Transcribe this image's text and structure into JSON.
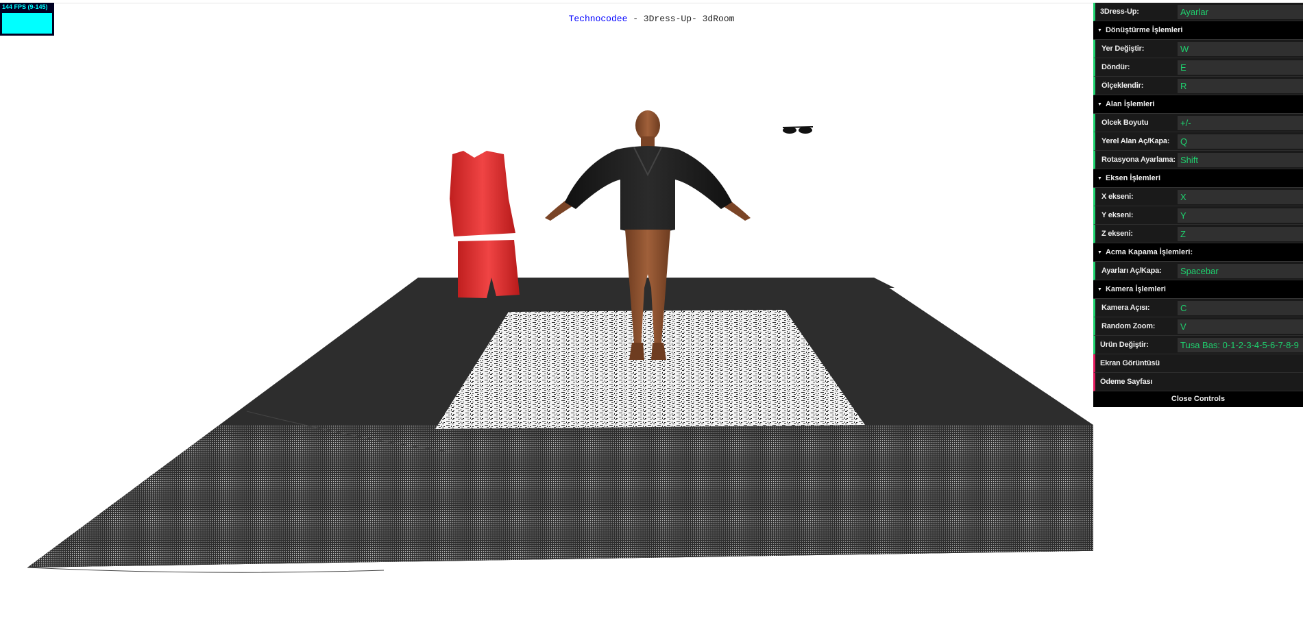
{
  "stats": {
    "fps_label": "144 FPS (9-145)"
  },
  "header": {
    "brand": "Technocodee",
    "subtitle": " - 3Dress-Up- 3dRoom"
  },
  "gui": {
    "root": {
      "name": "3Dress-Up:",
      "value": "Ayarlar"
    },
    "folders": [
      {
        "title": "Dönüştürme İşlemleri",
        "rows": [
          {
            "name": "Yer Değiştir:",
            "value": "W"
          },
          {
            "name": "Döndür:",
            "value": "E"
          },
          {
            "name": "Ölçeklendir:",
            "value": "R"
          }
        ]
      },
      {
        "title": "Alan İşlemleri",
        "rows": [
          {
            "name": "Olcek Boyutu",
            "value": "+/-"
          },
          {
            "name": "Yerel Alan Aç/Kapa:",
            "value": "Q"
          },
          {
            "name": "Rotasyona Ayarlama:",
            "value": "Shift"
          }
        ]
      },
      {
        "title": "Eksen İşlemleri",
        "rows": [
          {
            "name": "X ekseni:",
            "value": "X"
          },
          {
            "name": "Y ekseni:",
            "value": "Y"
          },
          {
            "name": "Z ekseni:",
            "value": "Z"
          }
        ]
      },
      {
        "title": "Acma Kapama İşlemleri:",
        "rows": [
          {
            "name": "Ayarları Aç/Kapa:",
            "value": "Spacebar"
          }
        ]
      },
      {
        "title": "Kamera İşlemleri",
        "rows": [
          {
            "name": "Kamera Açısı:",
            "value": "C"
          },
          {
            "name": "Random Zoom:",
            "value": "V"
          }
        ]
      }
    ],
    "product": {
      "name": "Ürün Değiştir:",
      "value": "Tusa Bas: 0-1-2-3-4-5-6-7-8-9"
    },
    "screenshot_label": "Ekran Görüntüsü",
    "payment_label": "Ödeme Sayfası",
    "close_label": "Close Controls"
  },
  "colors": {
    "string_accent": "#1ed36f",
    "function_accent": "#e61d5f",
    "floor": "#2d2d2d",
    "outfit": "#e03232"
  }
}
